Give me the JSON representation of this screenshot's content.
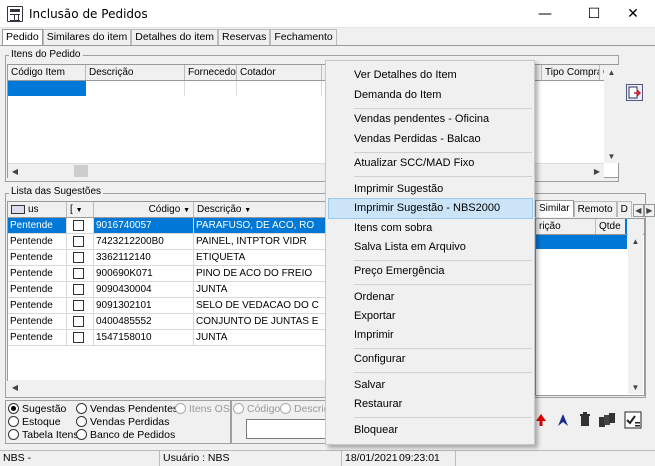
{
  "window": {
    "title": "Inclusão de Pedidos",
    "minimize": "—",
    "maximize": "☐",
    "close": "✕"
  },
  "tabs": [
    "Pedido",
    "Similares do item",
    "Detalhes do item",
    "Reservas",
    "Fechamento"
  ],
  "itens_panel": {
    "legend": "Itens do Pedido",
    "columns": [
      "Código Item",
      "Descrição",
      "Fornecedor",
      "Cotador",
      "F",
      "Tipo Compra",
      "C"
    ]
  },
  "sugestoes_panel": {
    "legend": "Lista das Sugestões",
    "columns": [
      "us",
      "[",
      "Código",
      "Descrição"
    ],
    "rows": [
      {
        "status": "Pentende",
        "codigo": "9016740057",
        "descricao": "PARAFUSO, DE ACO, RO"
      },
      {
        "status": "Pentende",
        "codigo": "7423212200B0",
        "descricao": "PAINEL, INTPTOR VIDR"
      },
      {
        "status": "Pentende",
        "codigo": "3362112140",
        "descricao": "ETIQUETA"
      },
      {
        "status": "Pentende",
        "codigo": "900690K071",
        "descricao": "PINO DE ACO DO FREIO"
      },
      {
        "status": "Pentende",
        "codigo": "9090430004",
        "descricao": "JUNTA"
      },
      {
        "status": "Pentende",
        "codigo": "9091302101",
        "descricao": "SELO DE VEDACAO DO C"
      },
      {
        "status": "Pentende",
        "codigo": "0400485552",
        "descricao": "CONJUNTO DE JUNTAS E"
      },
      {
        "status": "Pentende",
        "codigo": "1547158010",
        "descricao": "JUNTA"
      }
    ]
  },
  "right_panel": {
    "tabs": [
      "Similar",
      "Remoto",
      "D"
    ],
    "columns": [
      "rição",
      "Qtde"
    ]
  },
  "context_menu": [
    "Ver Detalhes do Item",
    "Demanda do Item",
    "Vendas pendentes - Oficina",
    "Vendas Perdidas - Balcao",
    "Atualizar SCC/MAD Fixo",
    "Imprimir Sugestão",
    "Imprimir Sugestão - NBS2000",
    "Itens com sobra",
    "Salva Lista em Arquivo",
    "Preço Emergência",
    "Ordenar",
    "Exportar",
    "Imprimir",
    "Configurar",
    "Salvar",
    "Restaurar",
    "Bloquear"
  ],
  "filters": {
    "sugestao": "Sugestão",
    "vendas_pendentes": "Vendas Pendentes",
    "itens_os": "Itens OS",
    "estoque": "Estoque",
    "vendas_perdidas": "Vendas Perdidas",
    "tabela_itens": "Tabela Itens",
    "banco_pedidos": "Banco de Pedidos",
    "codigo": "Código",
    "descricao": "Descriç"
  },
  "status_bar": {
    "left": "NBS -",
    "usuario": "Usuário : NBS",
    "date": "18/01/2021",
    "time": "09:23:01"
  }
}
